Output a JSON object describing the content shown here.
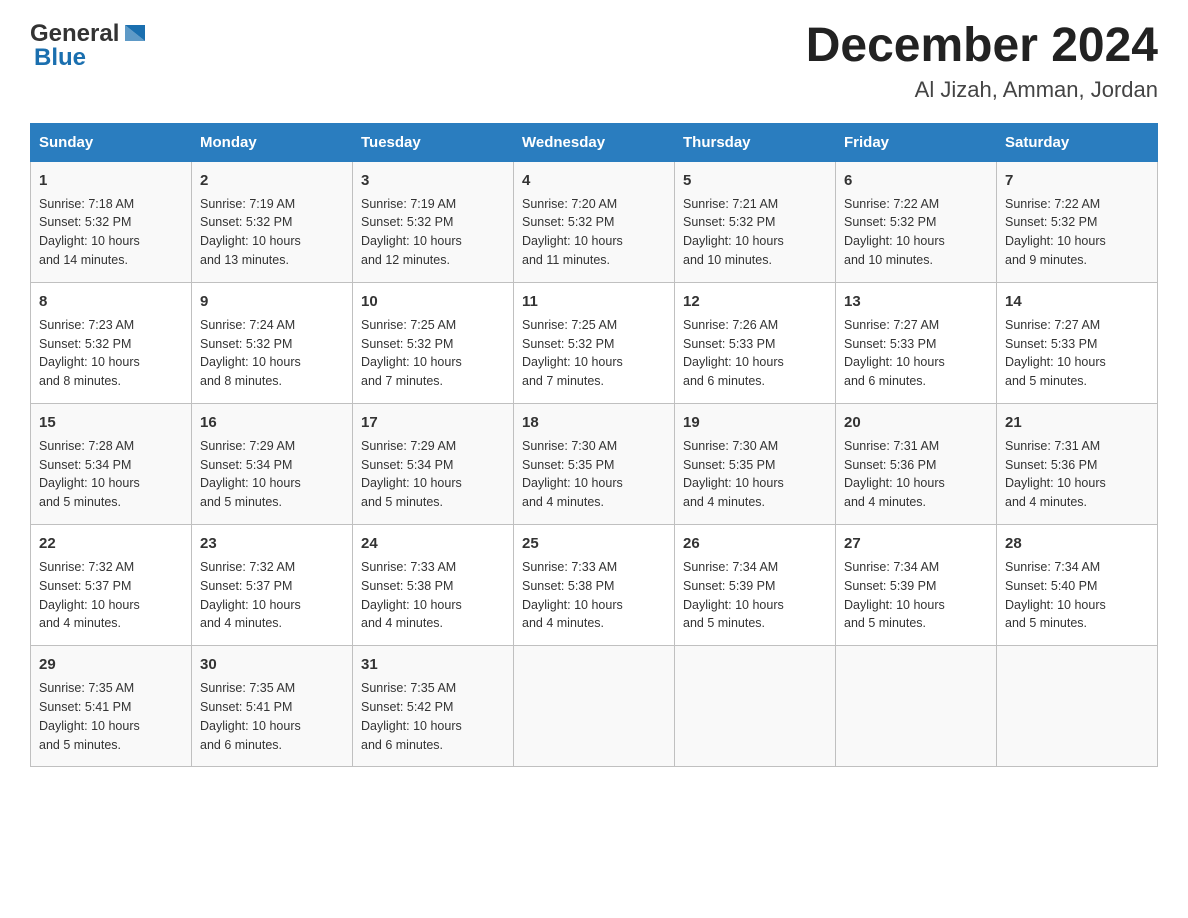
{
  "header": {
    "logo": {
      "general": "General",
      "blue": "Blue"
    },
    "month_title": "December 2024",
    "location": "Al Jizah, Amman, Jordan"
  },
  "weekdays": [
    "Sunday",
    "Monday",
    "Tuesday",
    "Wednesday",
    "Thursday",
    "Friday",
    "Saturday"
  ],
  "weeks": [
    [
      {
        "day": "1",
        "sunrise": "7:18 AM",
        "sunset": "5:32 PM",
        "daylight": "10 hours and 14 minutes."
      },
      {
        "day": "2",
        "sunrise": "7:19 AM",
        "sunset": "5:32 PM",
        "daylight": "10 hours and 13 minutes."
      },
      {
        "day": "3",
        "sunrise": "7:19 AM",
        "sunset": "5:32 PM",
        "daylight": "10 hours and 12 minutes."
      },
      {
        "day": "4",
        "sunrise": "7:20 AM",
        "sunset": "5:32 PM",
        "daylight": "10 hours and 11 minutes."
      },
      {
        "day": "5",
        "sunrise": "7:21 AM",
        "sunset": "5:32 PM",
        "daylight": "10 hours and 10 minutes."
      },
      {
        "day": "6",
        "sunrise": "7:22 AM",
        "sunset": "5:32 PM",
        "daylight": "10 hours and 10 minutes."
      },
      {
        "day": "7",
        "sunrise": "7:22 AM",
        "sunset": "5:32 PM",
        "daylight": "10 hours and 9 minutes."
      }
    ],
    [
      {
        "day": "8",
        "sunrise": "7:23 AM",
        "sunset": "5:32 PM",
        "daylight": "10 hours and 8 minutes."
      },
      {
        "day": "9",
        "sunrise": "7:24 AM",
        "sunset": "5:32 PM",
        "daylight": "10 hours and 8 minutes."
      },
      {
        "day": "10",
        "sunrise": "7:25 AM",
        "sunset": "5:32 PM",
        "daylight": "10 hours and 7 minutes."
      },
      {
        "day": "11",
        "sunrise": "7:25 AM",
        "sunset": "5:32 PM",
        "daylight": "10 hours and 7 minutes."
      },
      {
        "day": "12",
        "sunrise": "7:26 AM",
        "sunset": "5:33 PM",
        "daylight": "10 hours and 6 minutes."
      },
      {
        "day": "13",
        "sunrise": "7:27 AM",
        "sunset": "5:33 PM",
        "daylight": "10 hours and 6 minutes."
      },
      {
        "day": "14",
        "sunrise": "7:27 AM",
        "sunset": "5:33 PM",
        "daylight": "10 hours and 5 minutes."
      }
    ],
    [
      {
        "day": "15",
        "sunrise": "7:28 AM",
        "sunset": "5:34 PM",
        "daylight": "10 hours and 5 minutes."
      },
      {
        "day": "16",
        "sunrise": "7:29 AM",
        "sunset": "5:34 PM",
        "daylight": "10 hours and 5 minutes."
      },
      {
        "day": "17",
        "sunrise": "7:29 AM",
        "sunset": "5:34 PM",
        "daylight": "10 hours and 5 minutes."
      },
      {
        "day": "18",
        "sunrise": "7:30 AM",
        "sunset": "5:35 PM",
        "daylight": "10 hours and 4 minutes."
      },
      {
        "day": "19",
        "sunrise": "7:30 AM",
        "sunset": "5:35 PM",
        "daylight": "10 hours and 4 minutes."
      },
      {
        "day": "20",
        "sunrise": "7:31 AM",
        "sunset": "5:36 PM",
        "daylight": "10 hours and 4 minutes."
      },
      {
        "day": "21",
        "sunrise": "7:31 AM",
        "sunset": "5:36 PM",
        "daylight": "10 hours and 4 minutes."
      }
    ],
    [
      {
        "day": "22",
        "sunrise": "7:32 AM",
        "sunset": "5:37 PM",
        "daylight": "10 hours and 4 minutes."
      },
      {
        "day": "23",
        "sunrise": "7:32 AM",
        "sunset": "5:37 PM",
        "daylight": "10 hours and 4 minutes."
      },
      {
        "day": "24",
        "sunrise": "7:33 AM",
        "sunset": "5:38 PM",
        "daylight": "10 hours and 4 minutes."
      },
      {
        "day": "25",
        "sunrise": "7:33 AM",
        "sunset": "5:38 PM",
        "daylight": "10 hours and 4 minutes."
      },
      {
        "day": "26",
        "sunrise": "7:34 AM",
        "sunset": "5:39 PM",
        "daylight": "10 hours and 5 minutes."
      },
      {
        "day": "27",
        "sunrise": "7:34 AM",
        "sunset": "5:39 PM",
        "daylight": "10 hours and 5 minutes."
      },
      {
        "day": "28",
        "sunrise": "7:34 AM",
        "sunset": "5:40 PM",
        "daylight": "10 hours and 5 minutes."
      }
    ],
    [
      {
        "day": "29",
        "sunrise": "7:35 AM",
        "sunset": "5:41 PM",
        "daylight": "10 hours and 5 minutes."
      },
      {
        "day": "30",
        "sunrise": "7:35 AM",
        "sunset": "5:41 PM",
        "daylight": "10 hours and 6 minutes."
      },
      {
        "day": "31",
        "sunrise": "7:35 AM",
        "sunset": "5:42 PM",
        "daylight": "10 hours and 6 minutes."
      },
      null,
      null,
      null,
      null
    ]
  ],
  "labels": {
    "sunrise": "Sunrise:",
    "sunset": "Sunset:",
    "daylight": "Daylight:"
  }
}
